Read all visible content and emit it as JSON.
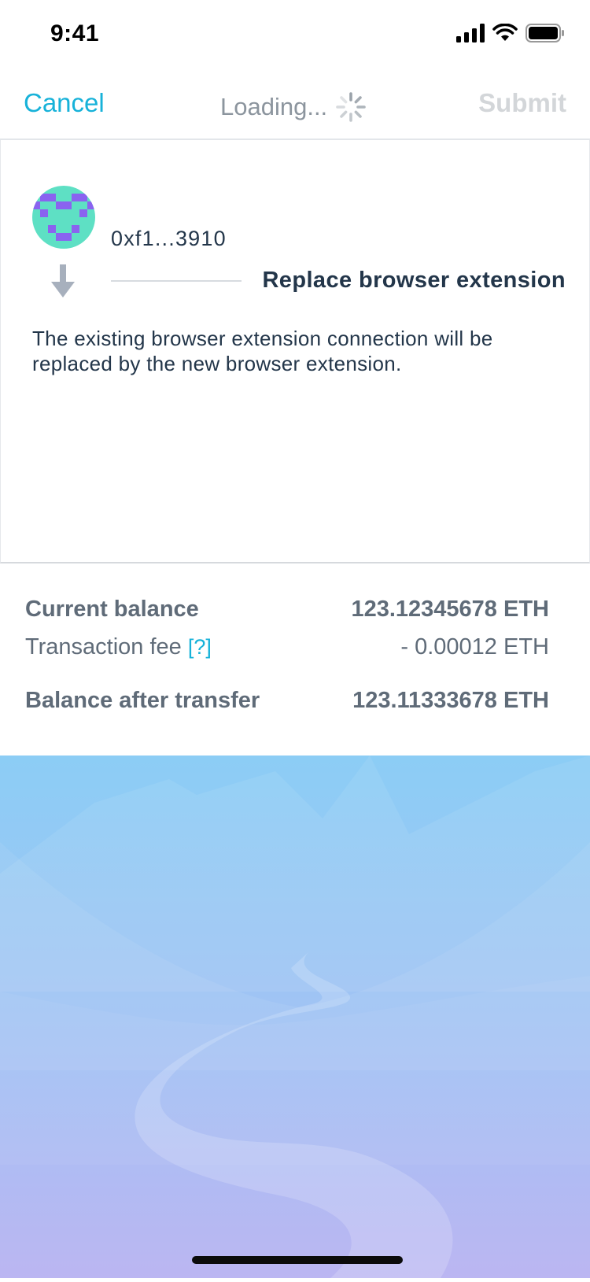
{
  "status_bar": {
    "time": "9:41"
  },
  "nav": {
    "cancel_label": "Cancel",
    "loading_label": "Loading...",
    "submit_label": "Submit"
  },
  "account": {
    "address": "0xf1...3910",
    "avatar_colors": {
      "base": "#5ee0c4",
      "pixel": "#8a63f0"
    }
  },
  "action": {
    "label": "Replace browser extension",
    "description": "The existing browser extension connection will be replaced by the new browser extension."
  },
  "balances": {
    "current": {
      "label": "Current balance",
      "value": "123.12345678 ETH"
    },
    "fee": {
      "label": "Transaction fee",
      "help": "[?]",
      "value": "- 0.00012 ETH"
    },
    "after": {
      "label": "Balance after transfer",
      "value": "123.11333678 ETH"
    }
  },
  "colors": {
    "accent": "#17b2d9",
    "text_dark": "#23364a",
    "text_muted": "#5f6b78",
    "disabled": "#d3d6d9",
    "sky_top": "#8fcdf5",
    "sky_bottom": "#b7b4f2"
  }
}
